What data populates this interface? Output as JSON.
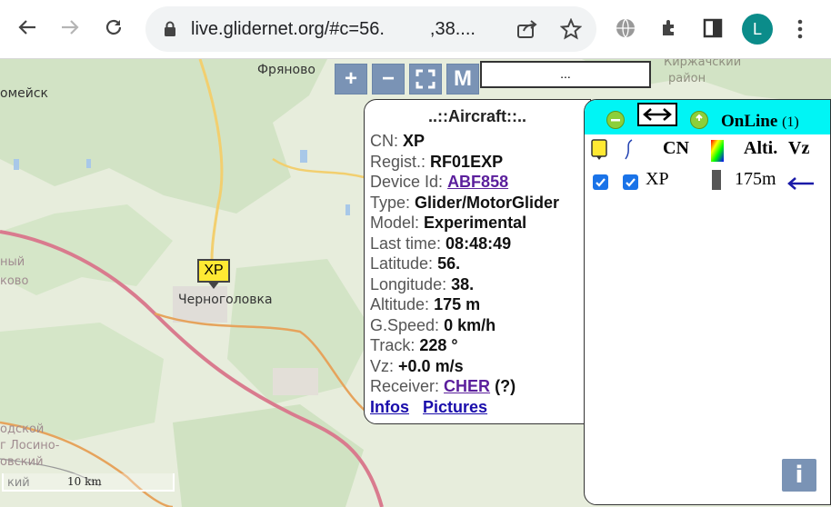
{
  "browser": {
    "url": "live.glidernet.org/#c=56.         ,38....",
    "avatar_letter": "L"
  },
  "map": {
    "controls": {
      "zoom_in": "+",
      "zoom_out": "−",
      "fullscreen": "",
      "mode": "M",
      "search_value": "..."
    },
    "labels": [
      "Фряново",
      "омейск",
      "Киржачский",
      "район",
      "Черноголовка",
      "одской",
      "г Лосино-",
      "овский",
      "кий",
      "ково",
      "ный"
    ],
    "marker_label": "XP",
    "scale_label": "10 km"
  },
  "aircraft": {
    "title": "..::Aircraft::..",
    "fields": {
      "cn": {
        "k": "CN:",
        "v": "XP"
      },
      "regist": {
        "k": "Regist.:",
        "v": "RF01EXP"
      },
      "device": {
        "k": "Device Id:",
        "v": "ABF858"
      },
      "type": {
        "k": "Type:",
        "v": "Glider/MotorGlider"
      },
      "model": {
        "k": "Model:",
        "v": "Experimental"
      },
      "last_time": {
        "k": "Last time:",
        "v": "08:48:49"
      },
      "lat": {
        "k": "Latitude:",
        "v": "56."
      },
      "lon": {
        "k": "Longitude:",
        "v": "38."
      },
      "alt": {
        "k": "Altitude:",
        "v": "175 m"
      },
      "gspeed": {
        "k": "G.Speed:",
        "v": "0 km/h"
      },
      "track": {
        "k": "Track:",
        "v": "228 °"
      },
      "vz": {
        "k": "Vz:",
        "v": "+0.0 m/s"
      },
      "receiver": {
        "k": "Receiver:",
        "v": "CHER",
        "extra": "(?)"
      }
    },
    "links": {
      "infos": "Infos",
      "pictures": "Pictures"
    }
  },
  "online": {
    "title": "OnLine",
    "count": "(1)",
    "columns": {
      "cn": "CN",
      "alti": "Alti.",
      "vz": "Vz"
    },
    "rows": [
      {
        "cn": "XP",
        "alt": "175m",
        "checked_show": true,
        "checked_track": true
      }
    ],
    "info_button": "i"
  },
  "colors": {
    "panel_header": "#00f5f5",
    "button_blue": "#7a93b5",
    "marker_yellow": "#ffe933"
  }
}
